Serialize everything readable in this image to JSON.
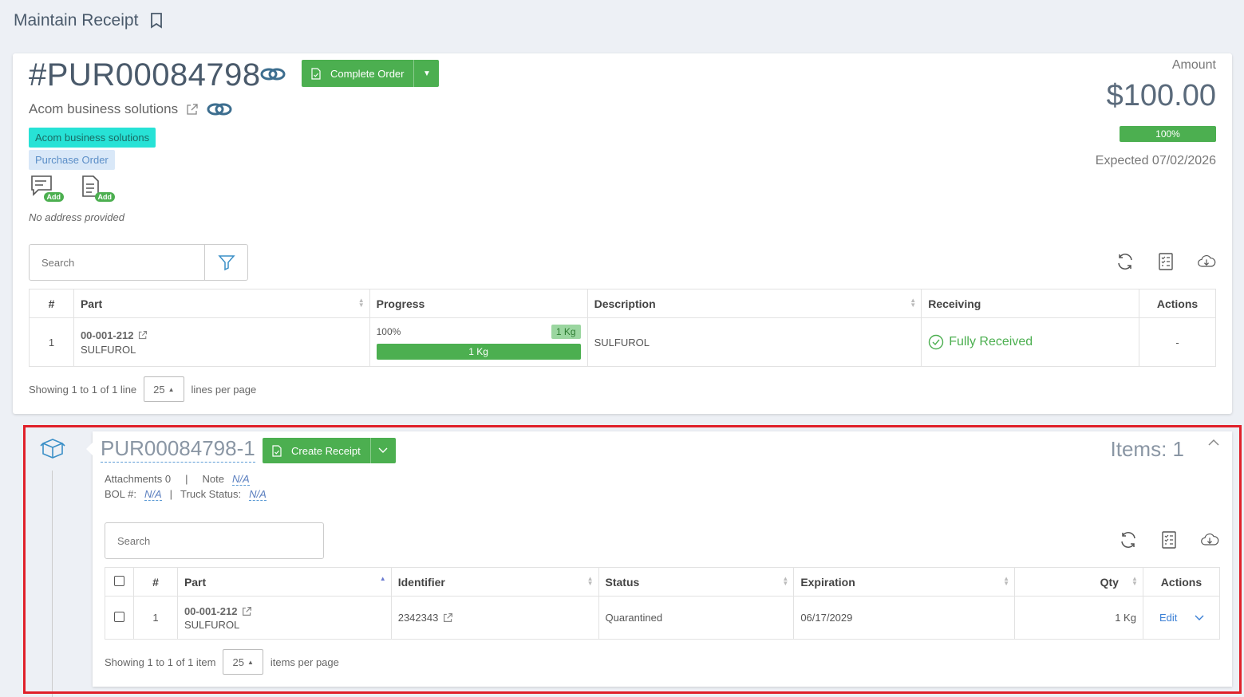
{
  "page": {
    "title": "Maintain Receipt"
  },
  "order": {
    "number": "#PUR00084798",
    "complete_label": "Complete Order",
    "vendor": "Acom business solutions",
    "tag_vendor": "Acom business solutions",
    "tag_type": "Purchase Order",
    "add_badge": "Add",
    "no_address": "No address provided",
    "amount_label": "Amount",
    "amount": "$100.00",
    "amount_progress": "100%",
    "expected": "Expected 07/02/2026"
  },
  "order_table": {
    "search_placeholder": "Search",
    "headers": {
      "num": "#",
      "part": "Part",
      "progress": "Progress",
      "description": "Description",
      "receiving": "Receiving",
      "actions": "Actions"
    },
    "rows": [
      {
        "num": "1",
        "part": "00-001-212",
        "part_name": "SULFUROL",
        "progress_pct": "100%",
        "qty_badge": "1 Kg",
        "progress_bar": "1 Kg",
        "description": "SULFUROL",
        "receiving": "Fully Received",
        "actions": "-"
      }
    ],
    "showing": "Showing 1 to 1 of 1 line",
    "page_size": "25",
    "per_page": "lines per page"
  },
  "receipt": {
    "number": "PUR00084798-1",
    "create_label": "Create Receipt",
    "items": "Items: 1",
    "attachments_label": "Attachments 0",
    "sep": "|",
    "note_label": "Note",
    "note_value": "N/A",
    "bol_label": "BOL #:",
    "bol_value": "N/A",
    "truck_label": "Truck Status:",
    "truck_value": "N/A",
    "search_placeholder": "Search",
    "headers": {
      "num": "#",
      "part": "Part",
      "identifier": "Identifier",
      "status": "Status",
      "expiration": "Expiration",
      "qty": "Qty",
      "actions": "Actions"
    },
    "rows": [
      {
        "num": "1",
        "part": "00-001-212",
        "part_name": "SULFUROL",
        "identifier": "2342343",
        "status": "Quarantined",
        "expiration": "06/17/2029",
        "qty": "1 Kg",
        "action": "Edit"
      }
    ],
    "showing": "Showing 1 to 1 of 1 item",
    "page_size": "25",
    "per_page": "items per page"
  }
}
